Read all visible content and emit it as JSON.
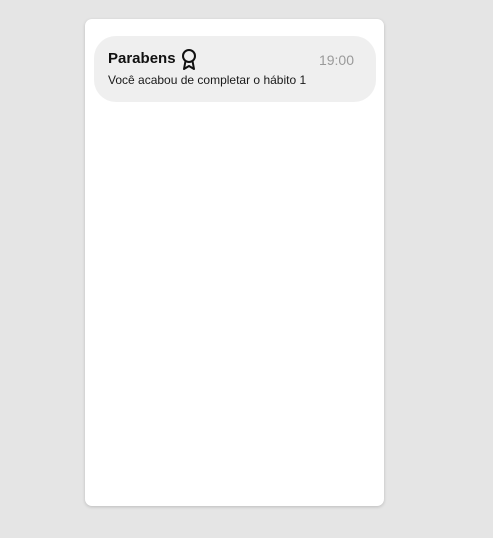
{
  "notification": {
    "title": "Parabens",
    "time": "19:00",
    "message": "Você acabou de completar o hábito 1",
    "icon": "award-ribbon-icon"
  },
  "colors": {
    "page_background": "#e5e5e5",
    "card_background": "#ffffff",
    "notification_background": "#efefef",
    "time_text": "#9a9a9a"
  }
}
